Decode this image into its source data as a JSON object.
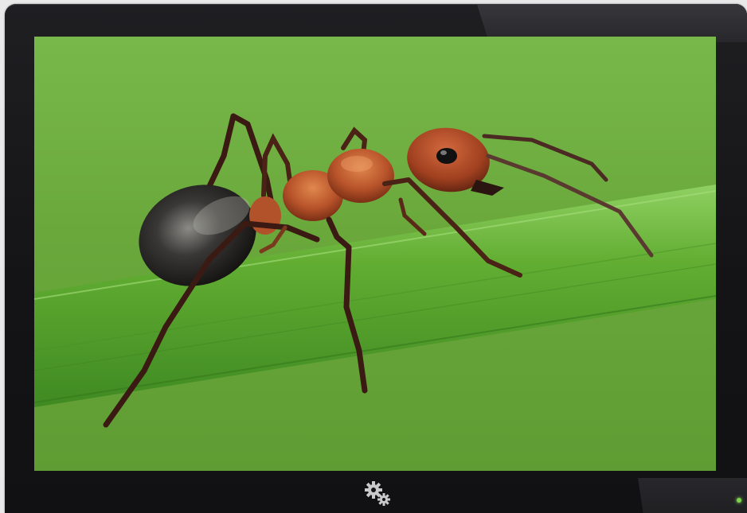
{
  "device": {
    "bezel_color": "#141416",
    "led_color": "#7cd64a"
  },
  "screen": {
    "image_subject": "ant-on-grass-blade-photo",
    "background_color": "#6bab3e",
    "grass_color": "#5aa131"
  },
  "controls": {
    "settings_icon": "gears-icon"
  }
}
